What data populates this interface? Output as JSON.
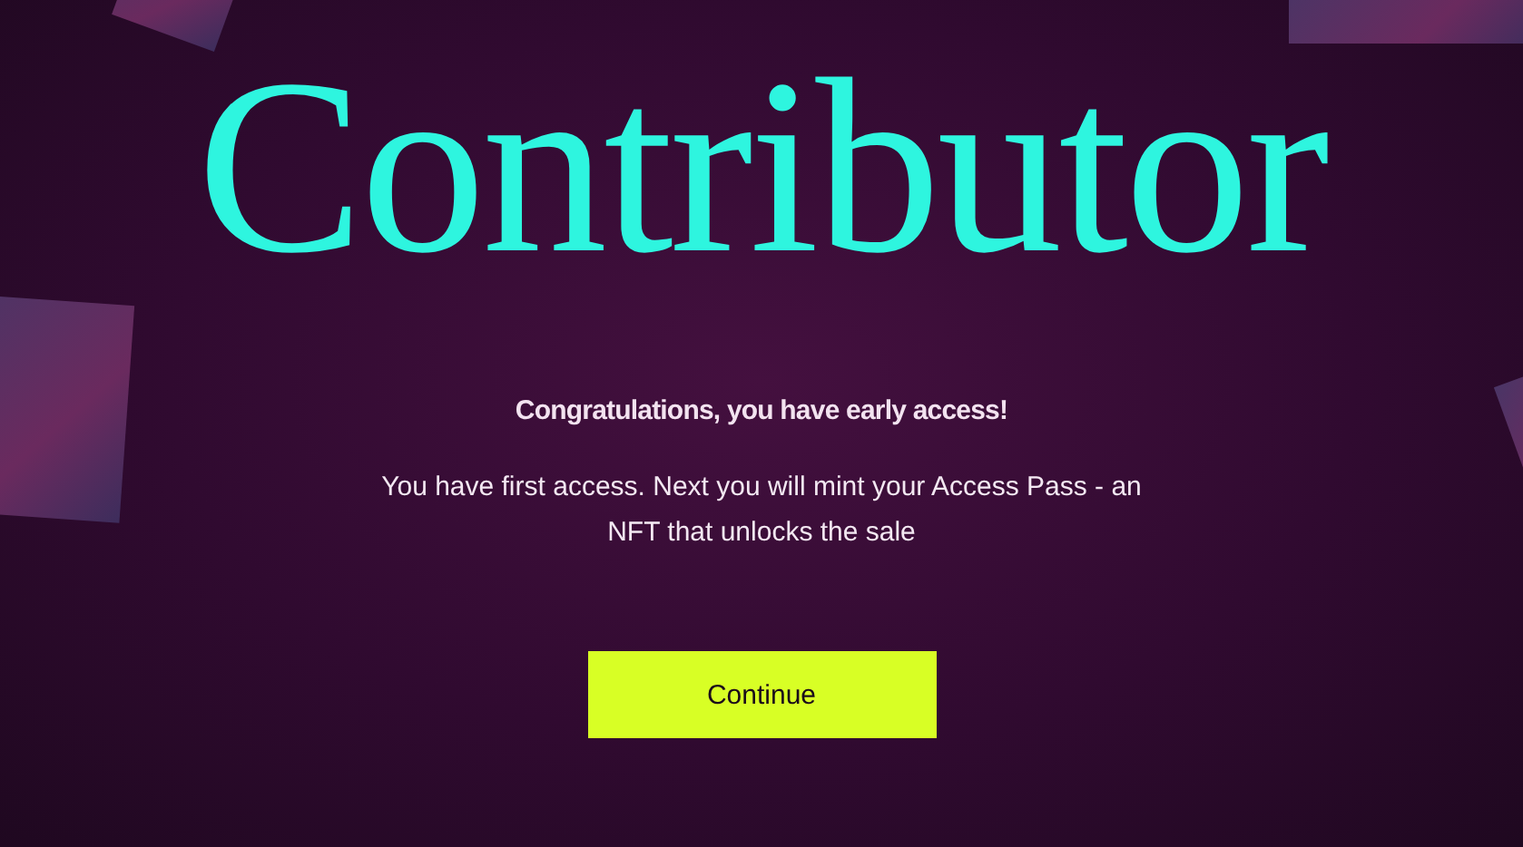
{
  "hero": {
    "title": "Contributor"
  },
  "message": {
    "heading": "Congratulations, you have early access!",
    "body": "You have first access. Next you will mint your Access Pass - an NFT that unlocks the sale"
  },
  "buttons": [
    {
      "label": "Continue"
    }
  ]
}
